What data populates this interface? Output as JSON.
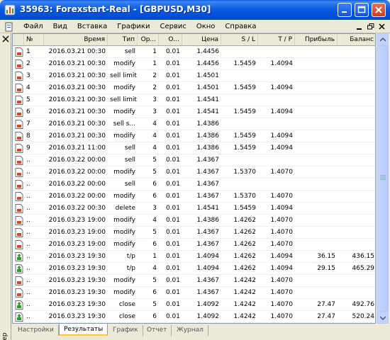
{
  "window": {
    "title": "35963: Forexstart-Real - [GBPUSD,M30]"
  },
  "menu": {
    "items": [
      "Файл",
      "Вид",
      "Вставка",
      "Графики",
      "Сервис",
      "Окно",
      "Справка"
    ]
  },
  "sidebar": {
    "label": "Тестер"
  },
  "table": {
    "columns": {
      "num": "№",
      "time": "Время",
      "type": "Тип",
      "order": "Ор...",
      "volume": "О...",
      "price": "Цена",
      "sl": "S / L",
      "tp": "T / P",
      "profit": "Прибыль",
      "balance": "Баланс"
    },
    "rows": [
      {
        "icon": "sell-doc-icon",
        "num": "1",
        "time": "2016.03.21 00:30",
        "type": "sell",
        "order": "1",
        "volume": "0.01",
        "price": "1.4456",
        "sl": "",
        "tp": "",
        "profit": "",
        "balance": ""
      },
      {
        "icon": "modify-doc-icon",
        "num": "2",
        "time": "2016.03.21 00:30",
        "type": "modify",
        "order": "1",
        "volume": "0.01",
        "price": "1.4456",
        "sl": "1.5459",
        "tp": "1.4094",
        "profit": "",
        "balance": ""
      },
      {
        "icon": "sell-limit-doc-icon",
        "num": "3",
        "time": "2016.03.21 00:30",
        "type": "sell limit",
        "order": "2",
        "volume": "0.01",
        "price": "1.4501",
        "sl": "",
        "tp": "",
        "profit": "",
        "balance": ""
      },
      {
        "icon": "modify-doc-icon",
        "num": "4",
        "time": "2016.03.21 00:30",
        "type": "modify",
        "order": "2",
        "volume": "0.01",
        "price": "1.4501",
        "sl": "1.5459",
        "tp": "1.4094",
        "profit": "",
        "balance": ""
      },
      {
        "icon": "sell-limit-doc-icon",
        "num": "5",
        "time": "2016.03.21 00:30",
        "type": "sell limit",
        "order": "3",
        "volume": "0.01",
        "price": "1.4541",
        "sl": "",
        "tp": "",
        "profit": "",
        "balance": ""
      },
      {
        "icon": "modify-doc-icon",
        "num": "6",
        "time": "2016.03.21 00:30",
        "type": "modify",
        "order": "3",
        "volume": "0.01",
        "price": "1.4541",
        "sl": "1.5459",
        "tp": "1.4094",
        "profit": "",
        "balance": ""
      },
      {
        "icon": "sell-stop-doc-icon",
        "num": "7",
        "time": "2016.03.21 00:30",
        "type": "sell s...",
        "order": "4",
        "volume": "0.01",
        "price": "1.4386",
        "sl": "",
        "tp": "",
        "profit": "",
        "balance": ""
      },
      {
        "icon": "modify-doc-icon",
        "num": "8",
        "time": "2016.03.21 00:30",
        "type": "modify",
        "order": "4",
        "volume": "0.01",
        "price": "1.4386",
        "sl": "1.5459",
        "tp": "1.4094",
        "profit": "",
        "balance": ""
      },
      {
        "icon": "sell-doc-icon",
        "num": "9",
        "time": "2016.03.21 11:00",
        "type": "sell",
        "order": "4",
        "volume": "0.01",
        "price": "1.4386",
        "sl": "1.5459",
        "tp": "1.4094",
        "profit": "",
        "balance": ""
      },
      {
        "icon": "sell-doc-icon",
        "num": "..",
        "time": "2016.03.22 00:00",
        "type": "sell",
        "order": "5",
        "volume": "0.01",
        "price": "1.4367",
        "sl": "",
        "tp": "",
        "profit": "",
        "balance": ""
      },
      {
        "icon": "modify-doc-icon",
        "num": "..",
        "time": "2016.03.22 00:00",
        "type": "modify",
        "order": "5",
        "volume": "0.01",
        "price": "1.4367",
        "sl": "1.5370",
        "tp": "1.4070",
        "profit": "",
        "balance": ""
      },
      {
        "icon": "sell-doc-icon",
        "num": "..",
        "time": "2016.03.22 00:00",
        "type": "sell",
        "order": "6",
        "volume": "0.01",
        "price": "1.4367",
        "sl": "",
        "tp": "",
        "profit": "",
        "balance": ""
      },
      {
        "icon": "modify-doc-icon",
        "num": "..",
        "time": "2016.03.22 00:00",
        "type": "modify",
        "order": "6",
        "volume": "0.01",
        "price": "1.4367",
        "sl": "1.5370",
        "tp": "1.4070",
        "profit": "",
        "balance": ""
      },
      {
        "icon": "delete-doc-icon",
        "num": "..",
        "time": "2016.03.22 00:30",
        "type": "delete",
        "order": "3",
        "volume": "0.01",
        "price": "1.4541",
        "sl": "1.5459",
        "tp": "1.4094",
        "profit": "",
        "balance": ""
      },
      {
        "icon": "modify-doc-icon",
        "num": "..",
        "time": "2016.03.23 19:00",
        "type": "modify",
        "order": "4",
        "volume": "0.01",
        "price": "1.4386",
        "sl": "1.4262",
        "tp": "1.4070",
        "profit": "",
        "balance": ""
      },
      {
        "icon": "modify-doc-icon",
        "num": "..",
        "time": "2016.03.23 19:00",
        "type": "modify",
        "order": "5",
        "volume": "0.01",
        "price": "1.4367",
        "sl": "1.4262",
        "tp": "1.4070",
        "profit": "",
        "balance": ""
      },
      {
        "icon": "modify-doc-icon",
        "num": "..",
        "time": "2016.03.23 19:00",
        "type": "modify",
        "order": "6",
        "volume": "0.01",
        "price": "1.4367",
        "sl": "1.4262",
        "tp": "1.4070",
        "profit": "",
        "balance": ""
      },
      {
        "icon": "take-profit-doc-icon",
        "num": "..",
        "time": "2016.03.23 19:30",
        "type": "t/p",
        "order": "1",
        "volume": "0.01",
        "price": "1.4094",
        "sl": "1.4262",
        "tp": "1.4094",
        "profit": "36.15",
        "balance": "436.15"
      },
      {
        "icon": "take-profit-doc-icon",
        "num": "..",
        "time": "2016.03.23 19:30",
        "type": "t/p",
        "order": "4",
        "volume": "0.01",
        "price": "1.4094",
        "sl": "1.4262",
        "tp": "1.4094",
        "profit": "29.15",
        "balance": "465.29"
      },
      {
        "icon": "modify-doc-icon",
        "num": "..",
        "time": "2016.03.23 19:30",
        "type": "modify",
        "order": "5",
        "volume": "0.01",
        "price": "1.4367",
        "sl": "1.4242",
        "tp": "1.4070",
        "profit": "",
        "balance": ""
      },
      {
        "icon": "modify-doc-icon",
        "num": "..",
        "time": "2016.03.23 19:30",
        "type": "modify",
        "order": "6",
        "volume": "0.01",
        "price": "1.4367",
        "sl": "1.4242",
        "tp": "1.4070",
        "profit": "",
        "balance": ""
      },
      {
        "icon": "close-doc-icon",
        "num": "..",
        "time": "2016.03.23 19:30",
        "type": "close",
        "order": "5",
        "volume": "0.01",
        "price": "1.4092",
        "sl": "1.4242",
        "tp": "1.4070",
        "profit": "27.47",
        "balance": "492.76"
      },
      {
        "icon": "close-doc-icon",
        "num": "..",
        "time": "2016.03.23 19:30",
        "type": "close",
        "order": "6",
        "volume": "0.01",
        "price": "1.4092",
        "sl": "1.4242",
        "tp": "1.4070",
        "profit": "27.47",
        "balance": "520.24"
      }
    ]
  },
  "tabs": [
    {
      "label": "Настройки",
      "active": false
    },
    {
      "label": "Результаты",
      "active": true
    },
    {
      "label": "График",
      "active": false
    },
    {
      "label": "Отчет",
      "active": false
    },
    {
      "label": "Журнал",
      "active": false
    }
  ],
  "colors": {
    "titlebar": "#0A5BE3",
    "sell_icon": "#D24A2A",
    "buy_icon": "#2E9B2E"
  }
}
